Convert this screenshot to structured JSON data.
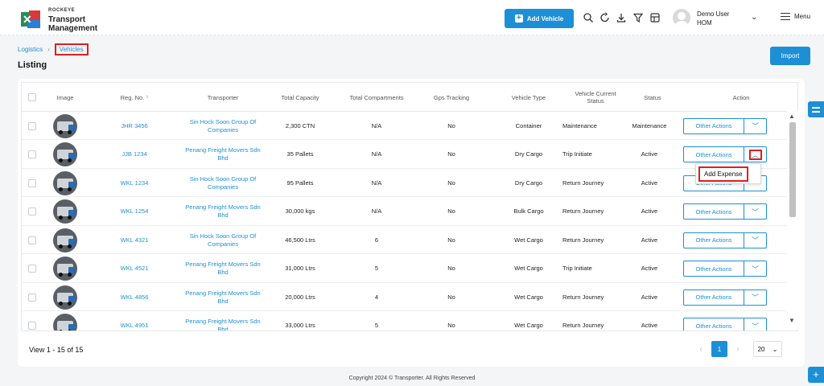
{
  "header": {
    "brand": "ROCKEYE",
    "app_line1": "Transport",
    "app_line2": "Management",
    "add_vehicle_label": "Add Vehicle",
    "user_name": "Demo User",
    "user_role": "HOM",
    "menu_label": "Menu",
    "icons": [
      "search-icon",
      "refresh-icon",
      "download-icon",
      "filter-icon",
      "layout-icon"
    ]
  },
  "breadcrumb": {
    "parent": "Logistics",
    "current": "Vehicles"
  },
  "page_title": "Listing",
  "import_label": "Import",
  "table": {
    "headers": [
      "Image",
      "Reg. No.",
      "Transporter",
      "Total Capacity",
      "Total Compartments",
      "Gps Tracking",
      "Vehicle Type",
      "Vehicle Current Status",
      "Status",
      "Action"
    ],
    "sort_indicator": "↕",
    "rows": [
      {
        "reg": "JHR 3456",
        "transporter": "Sin Hock Soon Group Of Companies",
        "capacity": "2,300 CTN",
        "compartments": "N/A",
        "gps": "No",
        "type": "Container",
        "current_status": "Maintenance",
        "status": "Maintenance",
        "action": "Other Actions"
      },
      {
        "reg": "JJB 1234",
        "transporter": "Penang Freight Movers Sdn Bhd",
        "capacity": "35 Pallets",
        "compartments": "N/A",
        "gps": "No",
        "type": "Dry Cargo",
        "current_status": "Trip Initiate",
        "status": "Active",
        "action": "Other Actions"
      },
      {
        "reg": "WKL 1234",
        "transporter": "Sin Hock Soon Group Of Companies",
        "capacity": "95 Pallets",
        "compartments": "N/A",
        "gps": "No",
        "type": "Dry Cargo",
        "current_status": "Return Journey",
        "status": "Active",
        "action": "Other Actions"
      },
      {
        "reg": "WKL 1254",
        "transporter": "Penang Freight Movers Sdn Bhd",
        "capacity": "30,000 kgs",
        "compartments": "N/A",
        "gps": "No",
        "type": "Bulk Cargo",
        "current_status": "Return Journey",
        "status": "Active",
        "action": "Other Actions"
      },
      {
        "reg": "WKL 4321",
        "transporter": "Sin Hock Soon Group Of Companies",
        "capacity": "46,500 Ltrs",
        "compartments": "6",
        "gps": "No",
        "type": "Wet Cargo",
        "current_status": "Return Journey",
        "status": "Active",
        "action": "Other Actions"
      },
      {
        "reg": "WKL 4521",
        "transporter": "Penang Freight Movers Sdn Bhd",
        "capacity": "31,000 Ltrs",
        "compartments": "5",
        "gps": "No",
        "type": "Wet Cargo",
        "current_status": "Trip Initiate",
        "status": "Active",
        "action": "Other Actions"
      },
      {
        "reg": "WKL 4856",
        "transporter": "Penang Freight Movers Sdn Bhd",
        "capacity": "20,000 Ltrs",
        "compartments": "4",
        "gps": "No",
        "type": "Wet Cargo",
        "current_status": "Return Journey",
        "status": "Active",
        "action": "Other Actions"
      },
      {
        "reg": "WKL 4951",
        "transporter": "Penang Freight Movers Sdn Bhd",
        "capacity": "33,000 Ltrs",
        "compartments": "5",
        "gps": "No",
        "type": "Wet Cargo",
        "current_status": "Return Journey",
        "status": "Active",
        "action": "Other Actions"
      }
    ]
  },
  "dropdown": {
    "item": "Add Expense"
  },
  "pagination": {
    "view_text": "View 1 - 15 of 15",
    "current_page": "1",
    "page_size": "20"
  },
  "footer": "Copyright 2024 © Transporter. All Rights Reserved",
  "colors": {
    "accent": "#1d8fd6",
    "highlight": "#e01e1e"
  }
}
